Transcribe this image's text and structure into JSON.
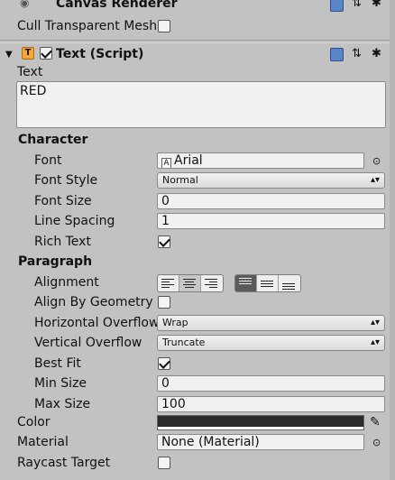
{
  "canvas_renderer": {
    "title": "Canvas Renderer",
    "cull_label": "Cull Transparent Mesh",
    "cull_checked": false
  },
  "text_component": {
    "title": "Text (Script)",
    "enabled": true,
    "text_label": "Text",
    "text_value": "RED"
  },
  "character": {
    "header": "Character",
    "font_label": "Font",
    "font_value": "Arial",
    "font_style_label": "Font Style",
    "font_style_value": "Normal",
    "font_size_label": "Font Size",
    "font_size_value": "0",
    "line_spacing_label": "Line Spacing",
    "line_spacing_value": "1",
    "rich_text_label": "Rich Text",
    "rich_text_checked": true
  },
  "paragraph": {
    "header": "Paragraph",
    "alignment_label": "Alignment",
    "align_by_geometry_label": "Align By Geometry",
    "align_by_geometry_checked": false,
    "horizontal_overflow_label": "Horizontal Overflow",
    "horizontal_overflow_value": "Wrap",
    "vertical_overflow_label": "Vertical Overflow",
    "vertical_overflow_value": "Truncate",
    "best_fit_label": "Best Fit",
    "best_fit_checked": true,
    "min_size_label": "Min Size",
    "min_size_value": "0",
    "max_size_label": "Max Size",
    "max_size_value": "100"
  },
  "color": {
    "label": "Color",
    "value_hex": "#2a2a2a"
  },
  "material": {
    "label": "Material",
    "value": "None (Material)"
  },
  "raycast": {
    "label": "Raycast Target",
    "checked": false
  },
  "icons": {
    "dropdown_arrow": "▴▾",
    "object_picker": "⊙",
    "settings": "✱"
  }
}
